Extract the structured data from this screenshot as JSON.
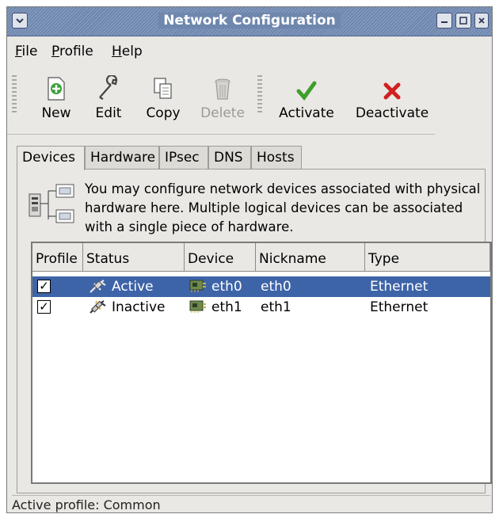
{
  "window": {
    "title": "Network Configuration"
  },
  "menu": [
    {
      "label": "File",
      "mnemonic": "F"
    },
    {
      "label": "Profile",
      "mnemonic": "P"
    },
    {
      "label": "Help",
      "mnemonic": "H"
    }
  ],
  "toolbar": {
    "new": "New",
    "edit": "Edit",
    "copy": "Copy",
    "delete": "Delete",
    "activate": "Activate",
    "deactivate": "Deactivate"
  },
  "tabs": [
    "Devices",
    "Hardware",
    "IPsec",
    "DNS",
    "Hosts"
  ],
  "info": "You may configure network devices associated with physical hardware here.  Multiple logical devices can be associated with a single piece of hardware.",
  "table": {
    "headers": [
      "Profile",
      "Status",
      "Device",
      "Nickname",
      "Type"
    ],
    "rows": [
      {
        "profile": "✓",
        "status": "Active",
        "device": "eth0",
        "nickname": "eth0",
        "type": "Ethernet",
        "selected": true
      },
      {
        "profile": "✓",
        "status": "Inactive",
        "device": "eth1",
        "nickname": "eth1",
        "type": "Ethernet",
        "selected": false
      }
    ]
  },
  "statusbar": "Active profile: Common",
  "colors": {
    "selection": "#3e64a8",
    "titlebar": "#6f86ad",
    "window_bg": "#e9e8e4"
  }
}
